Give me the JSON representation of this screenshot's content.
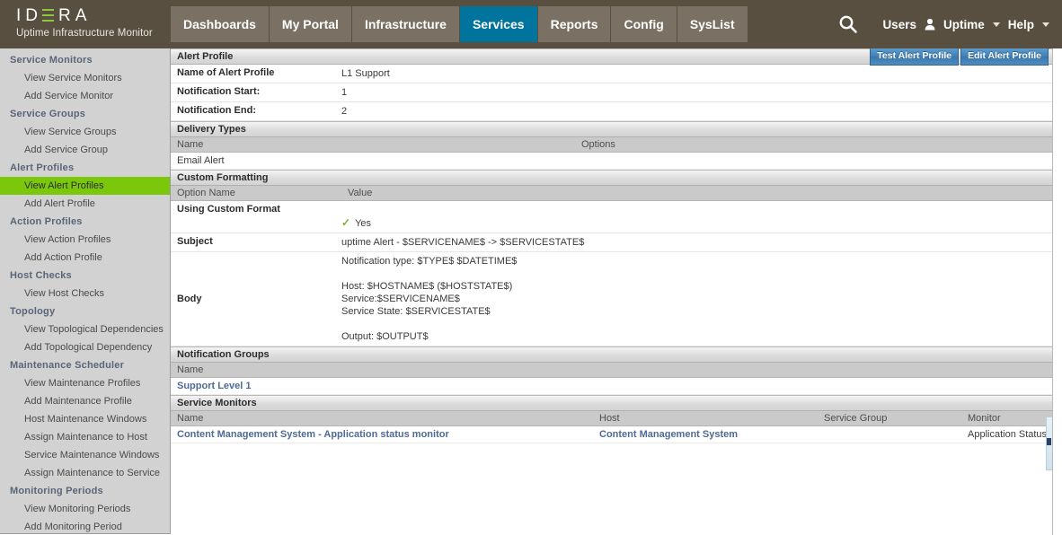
{
  "brand": {
    "name_letters": [
      "I",
      "D",
      "E",
      "R",
      "A"
    ],
    "name": "IDERA",
    "subtitle": "Uptime Infrastructure Monitor",
    "accent_green": "#8cc63e"
  },
  "header": {
    "bg": "#584f40",
    "active_tab_bg": "#00749c",
    "nav": [
      {
        "label": "Dashboards",
        "active": false
      },
      {
        "label": "My Portal",
        "active": false
      },
      {
        "label": "Infrastructure",
        "active": false
      },
      {
        "label": "Services",
        "active": true
      },
      {
        "label": "Reports",
        "active": false
      },
      {
        "label": "Config",
        "active": false
      },
      {
        "label": "SysList",
        "active": false
      }
    ],
    "search_icon": "search-icon",
    "users_label": "Users",
    "user_icon": "user-icon",
    "account_label": "Uptime",
    "help_label": "Help"
  },
  "sidebar": {
    "highlight_color": "#7ac70c",
    "groups": [
      {
        "title": "Service Monitors",
        "items": [
          {
            "label": "View Service Monitors",
            "active": false
          },
          {
            "label": "Add Service Monitor",
            "active": false
          }
        ]
      },
      {
        "title": "Service Groups",
        "items": [
          {
            "label": "View Service Groups",
            "active": false
          },
          {
            "label": "Add Service Group",
            "active": false
          }
        ]
      },
      {
        "title": "Alert Profiles",
        "items": [
          {
            "label": "View Alert Profiles",
            "active": true
          },
          {
            "label": "Add Alert Profile",
            "active": false
          }
        ]
      },
      {
        "title": "Action Profiles",
        "items": [
          {
            "label": "View Action Profiles",
            "active": false
          },
          {
            "label": "Add Action Profile",
            "active": false
          }
        ]
      },
      {
        "title": "Host Checks",
        "items": [
          {
            "label": "View Host Checks",
            "active": false
          }
        ]
      },
      {
        "title": "Topology",
        "items": [
          {
            "label": "View Topological Dependencies",
            "active": false
          },
          {
            "label": "Add Topological Dependency",
            "active": false
          }
        ]
      },
      {
        "title": "Maintenance Scheduler",
        "items": [
          {
            "label": "View Maintenance Profiles",
            "active": false
          },
          {
            "label": "Add Maintenance Profile",
            "active": false
          },
          {
            "label": "Host Maintenance Windows",
            "active": false
          },
          {
            "label": "Assign Maintenance to Host",
            "active": false
          },
          {
            "label": "Service Maintenance Windows",
            "active": false
          },
          {
            "label": "Assign Maintenance to Service",
            "active": false
          }
        ]
      },
      {
        "title": "Monitoring Periods",
        "items": [
          {
            "label": "View Monitoring Periods",
            "active": false
          },
          {
            "label": "Add Monitoring Period",
            "active": false
          }
        ]
      }
    ]
  },
  "main": {
    "alert_profile": {
      "section_title": "Alert Profile",
      "test_button": "Test Alert Profile",
      "edit_button": "Edit Alert Profile",
      "fields": [
        {
          "label": "Name of Alert Profile",
          "value": "L1 Support"
        },
        {
          "label": "Notification Start:",
          "value": "1"
        },
        {
          "label": "Notification End:",
          "value": "2"
        }
      ]
    },
    "delivery_types": {
      "section_title": "Delivery Types",
      "columns": [
        "Name",
        "Options"
      ],
      "rows": [
        {
          "name": "Email Alert",
          "options": ""
        }
      ]
    },
    "custom_formatting": {
      "section_title": "Custom Formatting",
      "columns": [
        "Option Name",
        "Value"
      ],
      "using_custom_format_label": "Using Custom Format",
      "using_custom_format_value": "Yes",
      "subject_label": "Subject",
      "subject_value": "uptime Alert - $SERVICENAME$ -> $SERVICESTATE$",
      "body_label": "Body",
      "body_value": "Notification type: $TYPE$ $DATETIME$\n\nHost: $HOSTNAME$ ($HOSTSTATE$)\nService:$SERVICENAME$\nService State: $SERVICESTATE$\n\nOutput: $OUTPUT$"
    },
    "notification_groups": {
      "section_title": "Notification Groups",
      "columns": [
        "Name"
      ],
      "rows": [
        {
          "name": "Support Level 1"
        }
      ]
    },
    "service_monitors": {
      "section_title": "Service Monitors",
      "columns": [
        "Name",
        "Host",
        "Service Group",
        "Monitor"
      ],
      "rows": [
        {
          "name": "Content Management System - Application status monitor",
          "host": "Content Management System",
          "service_group": "",
          "monitor": "Application Status"
        }
      ]
    }
  }
}
